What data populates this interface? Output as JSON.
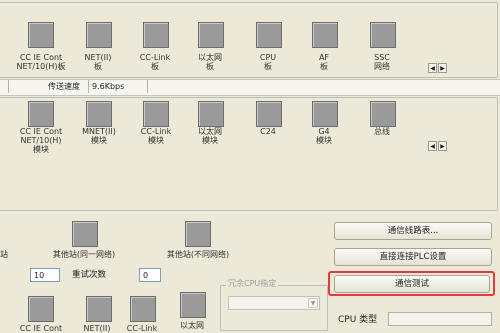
{
  "row1": {
    "items": [
      {
        "label": "CC IE Cont\nNET/10(H)板"
      },
      {
        "label": "NET(II)\n板"
      },
      {
        "label": "CC-Link\n板"
      },
      {
        "label": "以太网\n板"
      },
      {
        "label": "CPU\n板"
      },
      {
        "label": "AF\n板"
      },
      {
        "label": "SSC\n网络"
      }
    ]
  },
  "info_bar": {
    "title": "传送速度",
    "value": "9.6Kbps"
  },
  "row2": {
    "items": [
      {
        "label": "CC IE Cont\nNET/10(H)\n模块"
      },
      {
        "label": "MNET(II)\n模块"
      },
      {
        "label": "CC-Link\n模块"
      },
      {
        "label": "以太网\n模块"
      },
      {
        "label": "C24"
      },
      {
        "label": "G4\n模块"
      },
      {
        "label": "总线"
      }
    ]
  },
  "row3": {
    "items": [
      {
        "label": "站"
      },
      {
        "label": "其他站(同一网络)"
      },
      {
        "label": "其他站(不同网络)"
      }
    ]
  },
  "retry": {
    "left_value": "10",
    "label": "重试次数",
    "value": "0"
  },
  "multi_cpu": {
    "legend": "冗余CPU指定"
  },
  "buttons": {
    "route_table": "通信线路表...",
    "direct_plc": "直接连接PLC设置",
    "comm_test": "通信测试"
  },
  "cpu_type": {
    "label": "CPU 类型"
  },
  "row4": {
    "items": [
      {
        "label": "CC IE Cont"
      },
      {
        "label": "NET(II)"
      },
      {
        "label": "CC-Link"
      },
      {
        "label": "以太网"
      }
    ]
  },
  "colors": {
    "highlight": "#e53a3a",
    "background": "#ece9d8"
  }
}
